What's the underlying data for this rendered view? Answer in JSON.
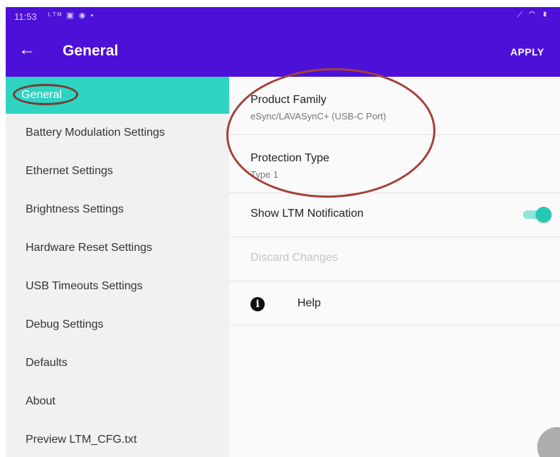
{
  "status_bar": {
    "time": "11:53",
    "left_icons": "ᴸᵀᴹ ▣ ◉ •",
    "right_icons": "⟋ ◠ ▮"
  },
  "appbar": {
    "title": "General",
    "back_icon": "arrow-left",
    "action": "APPLY"
  },
  "sidebar": {
    "items": [
      {
        "label": "General",
        "active": true
      },
      {
        "label": "Battery Modulation Settings"
      },
      {
        "label": "Ethernet Settings"
      },
      {
        "label": "Brightness Settings"
      },
      {
        "label": "Hardware Reset Settings"
      },
      {
        "label": "USB Timeouts Settings"
      },
      {
        "label": "Debug Settings"
      },
      {
        "label": "Defaults"
      },
      {
        "label": "About"
      },
      {
        "label": "Preview LTM_CFG.txt"
      }
    ]
  },
  "main": {
    "product_family": {
      "title": "Product Family",
      "value": "eSync/LAVASynC+ (USB-C Port)"
    },
    "protection_type": {
      "title": "Protection Type",
      "value": "Type 1"
    },
    "show_ltm_notification": {
      "label": "Show LTM Notification",
      "enabled": true
    },
    "discard_changes": {
      "label": "Discard Changes"
    },
    "help": {
      "label": "Help",
      "icon": "info-icon"
    }
  },
  "colors": {
    "primary": "#4c10d8",
    "accent": "#2ed3c1",
    "annotation": "#a4403a"
  }
}
